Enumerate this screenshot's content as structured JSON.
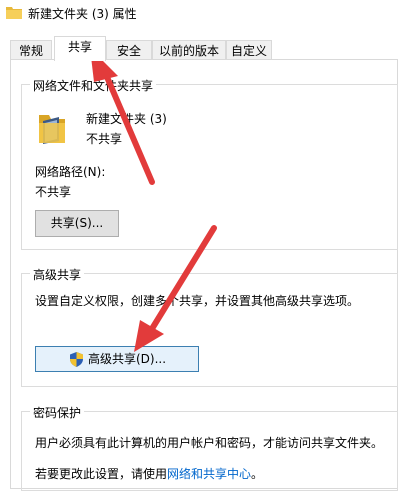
{
  "window": {
    "title": "新建文件夹 (3) 属性",
    "icon": "folder-icon"
  },
  "tabs": [
    {
      "label": "常规"
    },
    {
      "label": "共享"
    },
    {
      "label": "安全"
    },
    {
      "label": "以前的版本"
    },
    {
      "label": "自定义"
    }
  ],
  "active_tab": "共享",
  "network_share": {
    "group_label": "网络文件和文件夹共享",
    "folder_name": "新建文件夹 (3)",
    "share_status": "不共享",
    "path_label": "网络路径(N):",
    "path_value": "不共享",
    "share_button": "共享(S)..."
  },
  "advanced_share": {
    "group_label": "高级共享",
    "description": "设置自定义权限，创建多个共享，并设置其他高级共享选项。",
    "button_label": "高级共享(D)...",
    "button_icon": "shield-icon"
  },
  "password_protection": {
    "group_label": "密码保护",
    "description": "用户必须具有此计算机的用户帐户和密码，才能访问共享文件夹。",
    "change_prefix": "若要更改此设置，请使用",
    "link_text": "网络和共享中心",
    "change_suffix": "。"
  },
  "annotation_color": "#e23b3b"
}
